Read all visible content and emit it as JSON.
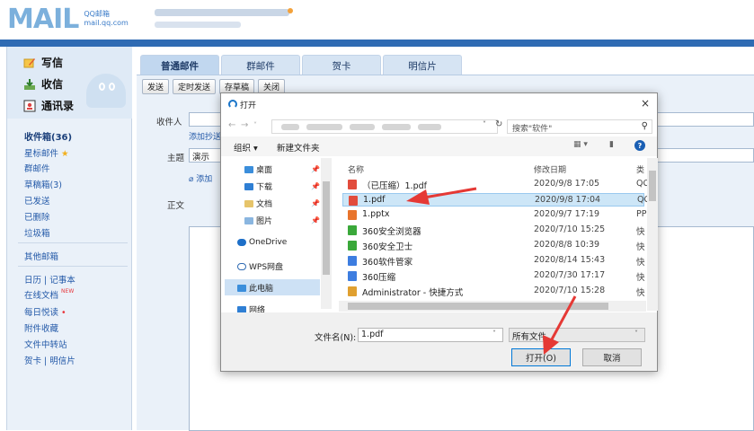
{
  "header": {
    "logo_text": "MAIL",
    "logo_sub_line1": "QQ邮箱",
    "logo_sub_line2": "mail.qq.com"
  },
  "sidebar": {
    "compose": "写信",
    "receive": "收信",
    "contacts": "通讯录",
    "inbox": "收件箱(36)",
    "items": [
      {
        "label": "星标邮件"
      },
      {
        "label": "群邮件"
      },
      {
        "label": "草稿箱(3)"
      },
      {
        "label": "已发送"
      },
      {
        "label": "已删除"
      },
      {
        "label": "垃圾箱"
      },
      {
        "label": "其他邮箱"
      },
      {
        "label": "日历 | 记事本"
      },
      {
        "label": "在线文档"
      },
      {
        "label": "每日悦读"
      },
      {
        "label": "附件收藏"
      },
      {
        "label": "文件中转站"
      },
      {
        "label": "贺卡 | 明信片"
      }
    ],
    "new_badge": "NEW"
  },
  "tabs": [
    {
      "label": "普通邮件"
    },
    {
      "label": "群邮件"
    },
    {
      "label": "贺卡"
    },
    {
      "label": "明信片"
    }
  ],
  "toolbar": {
    "send": "发送",
    "scheduled_send": "定时发送",
    "save_draft": "存草稿",
    "close": "关闭"
  },
  "form": {
    "recipient_label": "收件人",
    "add_cc": "添加抄送",
    "subject_label": "主题",
    "subject_value": "演示",
    "attach_link": "添加",
    "body_label": "正文"
  },
  "dialog": {
    "title": "打开",
    "close": "×",
    "search_placeholder": "搜索\"软件\"",
    "organize": "组织 ▾",
    "new_folder": "新建文件夹",
    "nav_items": [
      {
        "label": "桌面"
      },
      {
        "label": "下载"
      },
      {
        "label": "文档"
      },
      {
        "label": "图片"
      },
      {
        "label": "OneDrive"
      },
      {
        "label": "WPS网盘"
      },
      {
        "label": "此电脑"
      },
      {
        "label": "网络"
      }
    ],
    "columns": {
      "name": "名称",
      "modified": "修改日期",
      "type": "类"
    },
    "files": [
      {
        "name": "（已压缩）1.pdf",
        "date": "2020/9/8 17:05",
        "type": "QC",
        "icon_color": "#e24c3c"
      },
      {
        "name": "1.pdf",
        "date": "2020/9/8 17:04",
        "type": "QC",
        "icon_color": "#e24c3c",
        "selected": true
      },
      {
        "name": "1.pptx",
        "date": "2020/9/7 17:19",
        "type": "PP",
        "icon_color": "#e8742c"
      },
      {
        "name": "360安全浏览器",
        "date": "2020/7/10 15:25",
        "type": "快",
        "icon_color": "#3aa83a"
      },
      {
        "name": "360安全卫士",
        "date": "2020/8/8 10:39",
        "type": "快",
        "icon_color": "#3aa83a"
      },
      {
        "name": "360软件管家",
        "date": "2020/8/14 15:43",
        "type": "快",
        "icon_color": "#3d7de0"
      },
      {
        "name": "360压缩",
        "date": "2020/7/30 17:17",
        "type": "快",
        "icon_color": "#3d7de0"
      },
      {
        "name": "Administrator - 快捷方式",
        "date": "2020/7/10 15:28",
        "type": "快",
        "icon_color": "#e0a030"
      }
    ],
    "filename_label": "文件名(N):",
    "filename_value": "1.pdf",
    "filetype_value": "所有文件",
    "open_button": "打开(O)",
    "cancel_button": "取消"
  },
  "colors": {
    "header_bar": "#2f6bb3",
    "annotation_arrow": "#e53935"
  }
}
